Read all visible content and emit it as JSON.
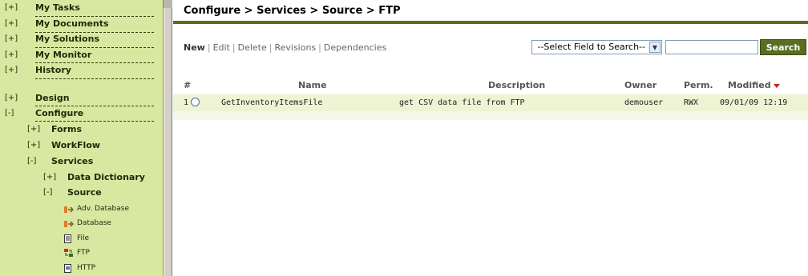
{
  "sidebar": {
    "top_items": [
      {
        "toggle": "[+]",
        "label": "My Tasks"
      },
      {
        "toggle": "[+]",
        "label": "My Documents"
      },
      {
        "toggle": "[+]",
        "label": "My Solutions"
      },
      {
        "toggle": "[+]",
        "label": "My Monitor"
      },
      {
        "toggle": "[+]",
        "label": "History"
      }
    ],
    "design": {
      "toggle": "[+]",
      "label": "Design"
    },
    "configure": {
      "toggle": "[-]",
      "label": "Configure"
    },
    "forms": {
      "toggle": "[+]",
      "label": "Forms"
    },
    "workflow": {
      "toggle": "[+]",
      "label": "WorkFlow"
    },
    "services": {
      "toggle": "[-]",
      "label": "Services"
    },
    "data_dictionary": {
      "toggle": "[+]",
      "label": "Data Dictionary"
    },
    "source": {
      "toggle": "[-]",
      "label": "Source"
    },
    "source_items": [
      {
        "label": "Adv. Database",
        "icon": "database-connector-icon"
      },
      {
        "label": "Database",
        "icon": "database-connector-icon"
      },
      {
        "label": "File",
        "icon": "file-icon"
      },
      {
        "label": "FTP",
        "icon": "ftp-icon"
      },
      {
        "label": "HTTP",
        "icon": "http-icon"
      }
    ]
  },
  "header": {
    "title": "Configure > Services > Source > FTP"
  },
  "toolbar": {
    "actions": [
      "New",
      "Edit",
      "Delete",
      "Revisions",
      "Dependencies"
    ],
    "field_select": "--Select Field to Search--",
    "search_value": "",
    "search_label": "Search"
  },
  "table": {
    "columns": {
      "index": "#",
      "name": "Name",
      "description": "Description",
      "owner": "Owner",
      "perm": "Perm.",
      "modified": "Modified"
    },
    "rows": [
      {
        "index": "1",
        "name": "GetInventoryItemsFile",
        "description": "get CSV data file from FTP",
        "owner": "demouser",
        "perm": "RWX",
        "modified": "09/01/09 12:19"
      }
    ]
  },
  "colors": {
    "sidebar_bg": "#d9e8a0",
    "accent": "#5b6d21",
    "row_bg": "#edf3d3",
    "sort_arrow": "#cc2200"
  }
}
